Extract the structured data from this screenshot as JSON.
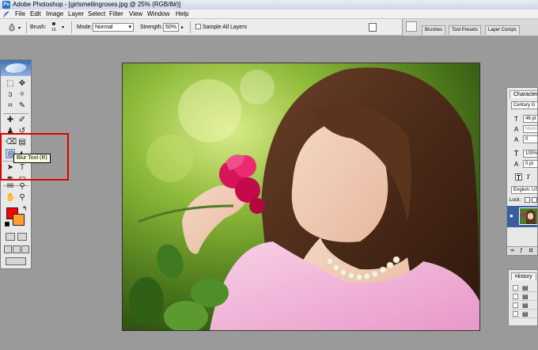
{
  "window": {
    "title": "Adobe Photoshop - [girlsmellingroses.jpg @ 25% (RGB/8#)]",
    "logo_text": "Ps"
  },
  "menu": [
    "File",
    "Edit",
    "Image",
    "Layer",
    "Select",
    "Filter",
    "View",
    "Window",
    "Help"
  ],
  "options_bar": {
    "brush_label": "Brush:",
    "brush_size": "13",
    "mode_label": "Mode:",
    "mode_value": "Normal",
    "strength_label": "Strength:",
    "strength_value": "50%",
    "sample_all_layers_label": "Sample All Layers",
    "sample_all_layers_checked": false
  },
  "palette_well": {
    "tabs": [
      "Brushes",
      "Tool Presets",
      "Layer Comps"
    ]
  },
  "toolbox": {
    "tooltip": "Blur Tool (R)",
    "foreground_color": "#ff0000",
    "background_color": "#ffa030",
    "active_tool": "blur-tool",
    "glyphs": {
      "marquee": "⬚",
      "move": "✥",
      "lasso": "ↄ",
      "magic_wand": "✧",
      "crop": "⌗",
      "slice": "✎",
      "healing": "✚",
      "brush": "✐",
      "stamp": "♟",
      "history_brush": "↺",
      "eraser": "⌫",
      "gradient": "▤",
      "blur": "◎",
      "dodge": "◐",
      "path_select": "➤",
      "type": "T",
      "pen": "✒",
      "shape": "▭",
      "notes": "✉",
      "eyedropper": "⚲",
      "hand": "✋",
      "zoom": "⚲",
      "std_mode": "▢",
      "quick_mask": "◙",
      "screen1": "▭",
      "screen2": "▭",
      "screen3": "▭",
      "jump": "⇨",
      "swap": "↰",
      "default": "■"
    }
  },
  "character_panel": {
    "tab": "Character",
    "font_family": "Century G",
    "font_size": "46 pt",
    "kerning": "Metric",
    "tracking": "0",
    "vertical_scale": "100%",
    "baseline_shift": "0 pt",
    "faux_bold": "T",
    "faux_italic": "T",
    "language": "English: US"
  },
  "layers_panel": {
    "lock_label": "Lock:"
  },
  "history_panel": {
    "tab": "History"
  },
  "colors": {
    "accent": "#3a5fa0",
    "highlight_box": "#e00000"
  }
}
